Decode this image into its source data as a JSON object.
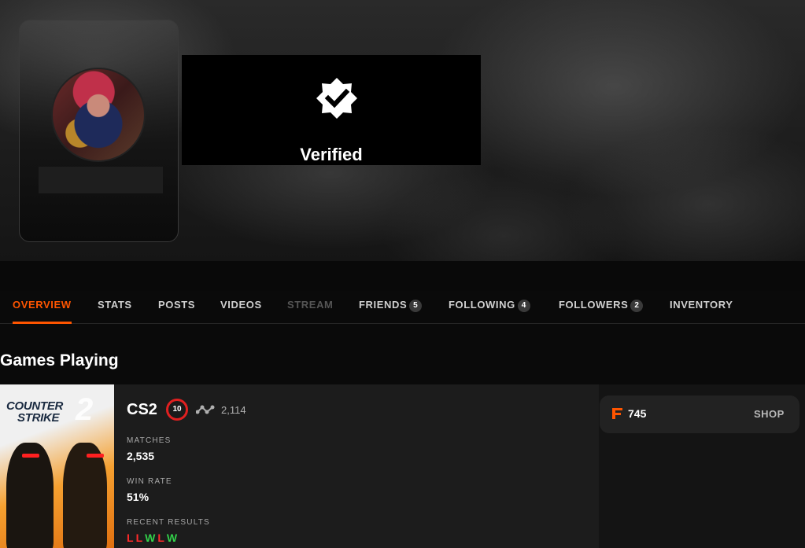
{
  "profile": {
    "verified_label": "Verified"
  },
  "nav": {
    "items": [
      {
        "label": "OVERVIEW",
        "state": "active"
      },
      {
        "label": "STATS"
      },
      {
        "label": "POSTS"
      },
      {
        "label": "VIDEOS"
      },
      {
        "label": "STREAM",
        "state": "disabled"
      },
      {
        "label": "FRIENDS",
        "count": "5"
      },
      {
        "label": "FOLLOWING",
        "count": "4"
      },
      {
        "label": "FOLLOWERS",
        "count": "2"
      },
      {
        "label": "INVENTORY"
      }
    ]
  },
  "games_section": {
    "title": "Games Playing"
  },
  "game": {
    "art_logo_line1": "COUNTER",
    "art_logo_line2": "STRIKE",
    "art_logo_number": "2",
    "name": "CS2",
    "level": "10",
    "elo": "2,114",
    "matches_label": "MATCHES",
    "matches_value": "2,535",
    "win_rate_label": "WIN RATE",
    "win_rate_value": "51%",
    "recent_label": "RECENT RESULTS",
    "recent_results": [
      "L",
      "L",
      "W",
      "L",
      "W"
    ]
  },
  "points": {
    "value": "745",
    "shop_label": "SHOP"
  },
  "colors": {
    "accent": "#ff5500",
    "loss": "#ff2a2a",
    "win": "#32d24a",
    "level_ring": "#e02020"
  },
  "icons": {
    "verified": "verified-badge-icon",
    "elo": "elo-graph-icon",
    "points": "faceit-points-icon"
  }
}
